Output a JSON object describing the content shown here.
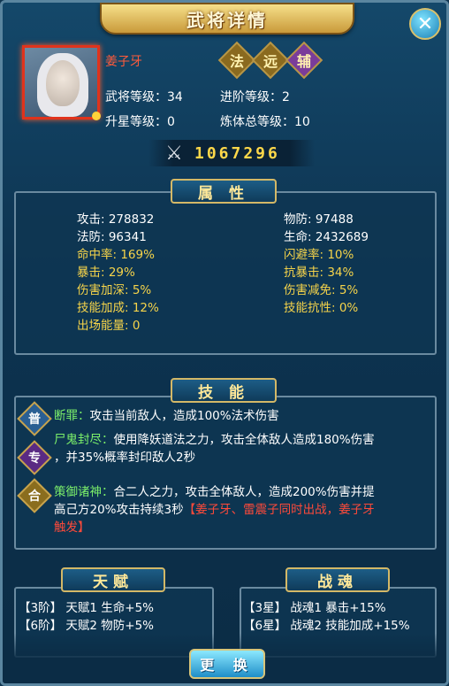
{
  "title": "武将详情",
  "hero": {
    "name": "姜子牙",
    "badges": [
      "法",
      "远",
      "辅"
    ],
    "stats": [
      {
        "label": "武将等级：34"
      },
      {
        "label": "进阶等级：2"
      },
      {
        "label": "升星等级：0"
      },
      {
        "label": "炼体总等级：10"
      }
    ],
    "power": "1067296"
  },
  "attributes": {
    "tab": "属  性",
    "rows": [
      [
        "攻击: 278832",
        "物防: 97488"
      ],
      [
        "法防: 96341",
        "生命: 2432689"
      ],
      [
        "命中率: 169%",
        "闪避率: 10%"
      ],
      [
        "暴击: 29%",
        "抗暴击: 34%"
      ],
      [
        "伤害加深: 5%",
        "伤害减免: 5%"
      ],
      [
        "技能加成: 12%",
        "技能抗性: 0%"
      ],
      [
        "出场能量: 0",
        ""
      ]
    ]
  },
  "skills": {
    "tab": "技  能",
    "icons": [
      "普",
      "专",
      "合"
    ],
    "s1_name": "断罪：",
    "s1_desc": "攻击当前敌人，造成100%法术伤害",
    "s2_name": "尸鬼封尽：",
    "s2_desc": "使用降妖道法之力，攻击全体敌人造成180%伤害",
    "s2_desc2": "，并35%概率封印敌人2秒",
    "s3_name": "策御诸神：",
    "s3_desc": "合二人之力，攻击全体敌人，造成200%伤害并提",
    "s3_desc2": "高己方20%攻击持续3秒",
    "s3_red": "【姜子牙、雷震子同时出战，姜子牙",
    "s3_red2": "触发】"
  },
  "talent": {
    "tab": "天赋",
    "items": [
      "【3阶】 天赋1 生命+5%",
      "【6阶】 天赋2 物防+5%"
    ]
  },
  "soul": {
    "tab": "战魂",
    "items": [
      "【3星】 战魂1 暴击+15%",
      "【6星】 战魂2 技能加成+15%"
    ]
  },
  "change_button": "更 换",
  "colors": {
    "accent_gold": "#d3b867",
    "red": "#ff4a3a",
    "green": "#7cf06a",
    "yellow": "#f6d44a"
  }
}
